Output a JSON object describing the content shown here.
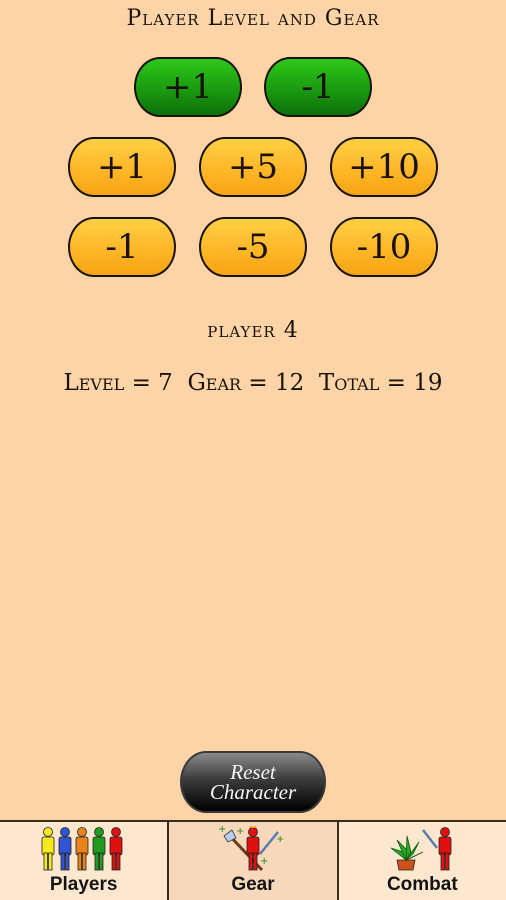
{
  "header": {
    "title": "Player Level and Gear"
  },
  "level_buttons": [
    {
      "label": "+1",
      "color": "#1a9a10"
    },
    {
      "label": "-1",
      "color": "#1a9a10"
    }
  ],
  "gear_buttons_plus": [
    {
      "label": "+1"
    },
    {
      "label": "+5"
    },
    {
      "label": "+10"
    }
  ],
  "gear_buttons_minus": [
    {
      "label": "-1"
    },
    {
      "label": "-5"
    },
    {
      "label": "-10"
    }
  ],
  "player": {
    "name": "player 4",
    "level_label": "Level =",
    "level": "7",
    "gear_label": "Gear =",
    "gear": "12",
    "total_label": "Total =",
    "total": "19"
  },
  "reset_button": {
    "line1": "Reset",
    "line2": "Character"
  },
  "tabs": [
    {
      "label": "Players",
      "icon": "players-icon",
      "active": false
    },
    {
      "label": "Gear",
      "icon": "gear-equipment-icon",
      "active": true
    },
    {
      "label": "Combat",
      "icon": "combat-icon",
      "active": false
    }
  ],
  "colors": {
    "background": "#fdd4a8",
    "green": "#1a9a10",
    "orange": "#ffb728",
    "player_colors": [
      "#f5e920",
      "#2f55d4",
      "#e8821a",
      "#1e9a1e",
      "#e01010"
    ]
  }
}
